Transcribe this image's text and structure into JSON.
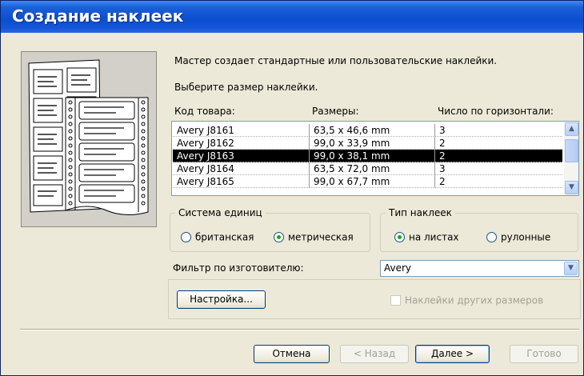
{
  "window": {
    "title": "Создание наклеек"
  },
  "intro": {
    "line1": "Мастер создает стандартные или пользовательские наклейки.",
    "line2": "Выберите размер наклейки."
  },
  "list": {
    "headers": [
      "Код товара:",
      "Размеры:",
      "Число по горизонтали:"
    ],
    "rows": [
      [
        "Avery J8161",
        "63,5 x 46,6 mm",
        "3"
      ],
      [
        "Avery J8162",
        "99,0 x 33,9 mm",
        "2"
      ],
      [
        "Avery J8163",
        "99,0 x 38,1 mm",
        "2"
      ],
      [
        "Avery J8164",
        "63,5 x 72,0 mm",
        "3"
      ],
      [
        "Avery J8165",
        "99,0 x 67,7 mm",
        "2"
      ]
    ],
    "selected_index": 2
  },
  "units": {
    "legend": "Система единиц",
    "options": [
      "британская",
      "метрическая"
    ],
    "selected": "метрическая"
  },
  "label_type": {
    "legend": "Тип наклеек",
    "options": [
      "на листах",
      "рулонные"
    ],
    "selected": "на листах"
  },
  "filter": {
    "label": "Фильтр по изготовителю:",
    "value": "Avery"
  },
  "customize_button": "Настройка...",
  "other_sizes_checkbox": "Наклейки других размеров",
  "buttons": {
    "cancel": "Отмена",
    "back": "< Назад",
    "next": "Далее >",
    "finish": "Готово"
  }
}
